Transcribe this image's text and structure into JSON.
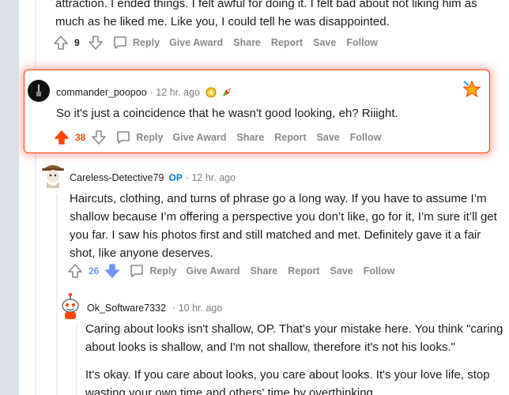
{
  "colors": {
    "upvote_active": "#ff4500",
    "downvote_active": "#7193ff",
    "muted": "#878a8c",
    "op_badge": "#0079d3"
  },
  "top_comment": {
    "text_line1": "attraction. I ended things. I felt awful for doing it. I felt bad about not liking him as",
    "text_line2": "much as he liked me. Like you, I could tell he was disappointed.",
    "votes": "9",
    "actions": [
      "Reply",
      "Give Award",
      "Share",
      "Report",
      "Save",
      "Follow"
    ]
  },
  "highlighted_comment": {
    "username": "commander_poopoo",
    "time": "· 12 hr. ago",
    "award_icons": [
      "gold-award-icon",
      "rocket-award-icon"
    ],
    "text": "So it's just a coincidence that he wasn't good looking, eh? Riiight.",
    "votes": "38",
    "actions": [
      "Reply",
      "Give Award",
      "Share",
      "Report",
      "Save",
      "Follow"
    ]
  },
  "reply_comment": {
    "username": "Careless-Detective79",
    "op_label": "OP",
    "time": "· 12 hr. ago",
    "lines": [
      "Haircuts, clothing, and turns of phrase go a long way. If you have to assume I’m",
      "shallow because I’m offering a perspective you don’t like, go for it, I’m sure it’ll get",
      "you far. I saw his photos first and still matched and met. Definitely gave it a fair",
      "shot, like anyone deserves."
    ],
    "votes": "26",
    "actions": [
      "Reply",
      "Give Award",
      "Share",
      "Report",
      "Save",
      "Follow"
    ]
  },
  "nested_comment": {
    "username": "Ok_Software7332",
    "time": "· 10 hr. ago",
    "para1": [
      "Caring about looks isn't shallow, OP. That's your mistake here. You think \"caring",
      "about looks is shallow, and I'm not shallow, therefore it's not his looks.\""
    ],
    "para2": [
      "It's okay. If you care about looks, you care about looks. It's your love life, stop",
      "wasting your own time and others' time by overthinking."
    ]
  }
}
